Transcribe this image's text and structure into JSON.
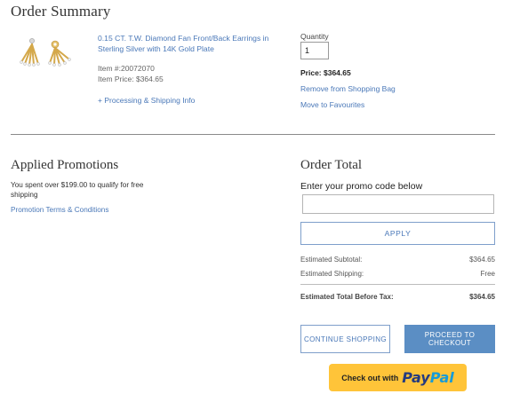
{
  "order_summary": {
    "title": "Order Summary",
    "product": {
      "image_icon": "diamond-fan-earrings-image",
      "name": "0.15 CT. T.W. Diamond Fan Front/Back Earrings in Sterling Silver with 14K Gold Plate",
      "item_number": "Item #:20072070",
      "item_price": "Item Price: $364.65",
      "shipping_link": "+ Processing & Shipping Info"
    },
    "quantity": {
      "label": "Quantity",
      "value": "1"
    },
    "price": "Price: $364.65",
    "remove_link": "Remove from Shopping Bag",
    "favourites_link": "Move to Favourites"
  },
  "promotions": {
    "title": "Applied Promotions",
    "message": "You spent over $199.00 to qualify for free shipping",
    "terms_link": "Promotion Terms & Conditions"
  },
  "order_total": {
    "title": "Order Total",
    "promo_label": "Enter your promo code below",
    "promo_value": "",
    "apply_label": "APPLY",
    "subtotal_label": "Estimated Subtotal:",
    "subtotal_value": "$364.65",
    "shipping_label": "Estimated Shipping:",
    "shipping_value": "Free",
    "total_label": "Estimated Total Before Tax:",
    "total_value": "$364.65",
    "continue_label": "CONTINUE SHOPPING",
    "checkout_label": "PROCEED TO CHECKOUT",
    "paypal_prefix": "Check out with",
    "paypal_pay": "Pay",
    "paypal_pal": "Pal"
  },
  "colors": {
    "link": "#4a78b8",
    "checkout_button": "#5b8ec4",
    "paypal_button": "#ffc439"
  }
}
